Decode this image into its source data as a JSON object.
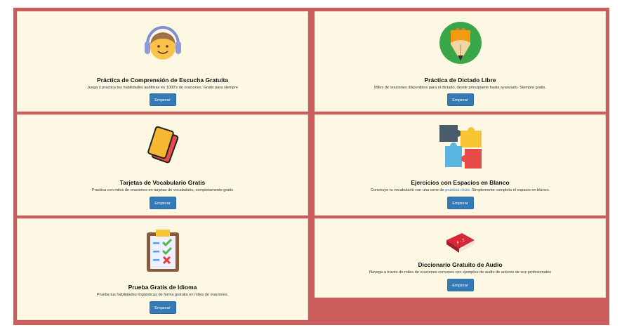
{
  "cards": [
    {
      "title": "Práctica de Comprensión de Escucha Gratuita",
      "description": "Juega y practica tus habilidades auditivas en 1000's de oraciones. Gratis para siempre",
      "button": "Empezar",
      "icon": "headphones-face-icon"
    },
    {
      "title": "Práctica de Dictado Libre",
      "description": "Miles de oraciones disponibles para el dictado, desde principiante hasta avanzado. Siempre gratis.",
      "button": "Empezar",
      "icon": "pencil-tip-icon"
    },
    {
      "title": "Tarjetas de Vocabulario Gratis",
      "description": "Practica con miles de oraciones en tarjetas de vocabulario, completamente gratis",
      "button": "Empezar",
      "icon": "flashcards-icon"
    },
    {
      "title": "Ejercicios con Espacios en Blanco",
      "description_before": "Construye tu vocabulario con una serie de ",
      "description_link": "pruebas cloze",
      "description_after": ". Simplemente completa el espacio en blanco.",
      "button": "Empezar",
      "icon": "puzzle-icon"
    },
    {
      "title": "Prueba Gratis de Idioma",
      "description": "Prueba tus habilidades lingüísticas de forma gratuita en miles de oraciones.",
      "button": "Empezar",
      "icon": "clipboard-checklist-icon"
    },
    {
      "title": "Diccionario Gratuito de Audio",
      "description": "Navega a través de miles de oraciones comunes con ejemplos de audio de actores de voz profesionales",
      "button": "Empezar",
      "icon": "dictionary-book-icon",
      "book_label": "A - Z"
    }
  ],
  "colors": {
    "frame": "#cd5c5c",
    "card_bg": "#fdf8e3",
    "button": "#337ab7"
  }
}
